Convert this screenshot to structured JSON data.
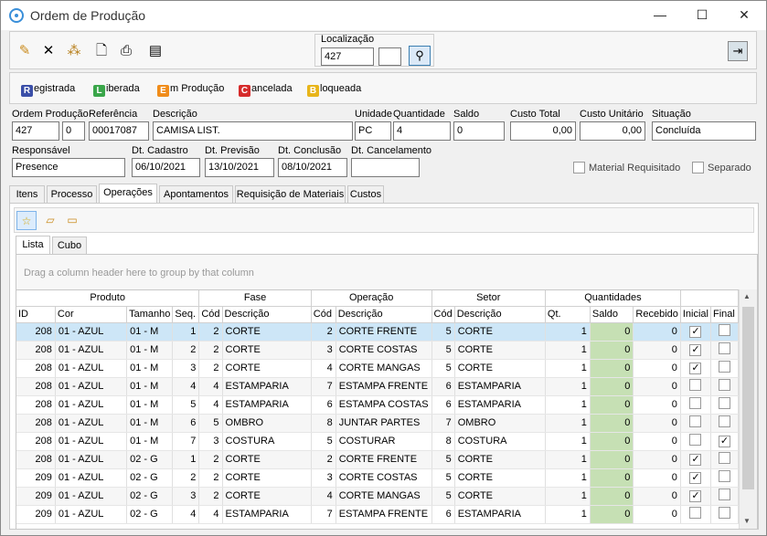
{
  "window": {
    "title": "Ordem de Produção",
    "minimize": "—",
    "maximize": "☐",
    "close": "✕"
  },
  "toolbar": {
    "localizacao_label": "Localização",
    "localizacao_value": "427",
    "localizacao_value2": ""
  },
  "legend": [
    {
      "letter": "R",
      "label": "egistrada",
      "color": "#3b4fa8"
    },
    {
      "letter": "L",
      "label": "iberada",
      "color": "#3aa64a"
    },
    {
      "letter": "E",
      "label": "m Produção",
      "color": "#f08c1a"
    },
    {
      "letter": "C",
      "label": "ancelada",
      "color": "#d62b2b"
    },
    {
      "letter": "B",
      "label": "loqueada",
      "color": "#e8b51a"
    }
  ],
  "form": {
    "ordem_producao_label": "Ordem Produção",
    "ordem_value": "427",
    "ordem_seq": "0",
    "referencia_label": "Referência",
    "referencia_value": "00017087",
    "descricao_label": "Descrição",
    "descricao_value": "CAMISA LIST.",
    "unidade_label": "Unidade",
    "unidade_value": "PC",
    "quantidade_label": "Quantidade",
    "quantidade_value": "4",
    "saldo_label": "Saldo",
    "saldo_value": "0",
    "custo_total_label": "Custo Total",
    "custo_total_value": "0,00",
    "custo_unitario_label": "Custo Unitário",
    "custo_unitario_value": "0,00",
    "situacao_label": "Situação",
    "situacao_value": "Concluída",
    "responsavel_label": "Responsável",
    "responsavel_value": "Presence",
    "dt_cadastro_label": "Dt. Cadastro",
    "dt_cadastro_value": "06/10/2021",
    "dt_previsao_label": "Dt. Previsão",
    "dt_previsao_value": "13/10/2021",
    "dt_conclusao_label": "Dt. Conclusão",
    "dt_conclusao_value": "08/10/2021",
    "dt_cancelamento_label": "Dt. Cancelamento",
    "dt_cancelamento_value": "",
    "material_requisitado_label": "Material Requisitado",
    "separado_label": "Separado"
  },
  "tabs": [
    "Itens",
    "Processo",
    "Operações",
    "Apontamentos",
    "Requisição de Materiais",
    "Custos"
  ],
  "active_tab": "Operações",
  "subtabs": [
    "Lista",
    "Cubo"
  ],
  "grid": {
    "group_hint": "Drag a column header here to group by that column",
    "groups": [
      "Produto",
      "Fase",
      "Operação",
      "Setor",
      "Quantidades"
    ],
    "columns": [
      "ID",
      "Cor",
      "Tamanho",
      "Seq.",
      "Cód",
      "Descrição",
      "Cód",
      "Descrição",
      "Cód",
      "Descrição",
      "Qt.",
      "Saldo",
      "Recebido",
      "Inicial",
      "Final"
    ],
    "rows": [
      {
        "id": "208",
        "cor": "01 - AZUL",
        "tam": "01 - M",
        "seq": "1",
        "fcod": "2",
        "fdesc": "CORTE",
        "ocod": "2",
        "odesc": "CORTE FRENTE",
        "scod": "5",
        "sdesc": "CORTE",
        "qt": "1",
        "saldo": "0",
        "rec": "0",
        "ini": true,
        "fin": false
      },
      {
        "id": "208",
        "cor": "01 - AZUL",
        "tam": "01 - M",
        "seq": "2",
        "fcod": "2",
        "fdesc": "CORTE",
        "ocod": "3",
        "odesc": "CORTE COSTAS",
        "scod": "5",
        "sdesc": "CORTE",
        "qt": "1",
        "saldo": "0",
        "rec": "0",
        "ini": true,
        "fin": false
      },
      {
        "id": "208",
        "cor": "01 - AZUL",
        "tam": "01 - M",
        "seq": "3",
        "fcod": "2",
        "fdesc": "CORTE",
        "ocod": "4",
        "odesc": "CORTE MANGAS",
        "scod": "5",
        "sdesc": "CORTE",
        "qt": "1",
        "saldo": "0",
        "rec": "0",
        "ini": true,
        "fin": false
      },
      {
        "id": "208",
        "cor": "01 - AZUL",
        "tam": "01 - M",
        "seq": "4",
        "fcod": "4",
        "fdesc": "ESTAMPARIA",
        "ocod": "7",
        "odesc": "ESTAMPA FRENTE",
        "scod": "6",
        "sdesc": "ESTAMPARIA",
        "qt": "1",
        "saldo": "0",
        "rec": "0",
        "ini": false,
        "fin": false
      },
      {
        "id": "208",
        "cor": "01 - AZUL",
        "tam": "01 - M",
        "seq": "5",
        "fcod": "4",
        "fdesc": "ESTAMPARIA",
        "ocod": "6",
        "odesc": "ESTAMPA COSTAS",
        "scod": "6",
        "sdesc": "ESTAMPARIA",
        "qt": "1",
        "saldo": "0",
        "rec": "0",
        "ini": false,
        "fin": false
      },
      {
        "id": "208",
        "cor": "01 - AZUL",
        "tam": "01 - M",
        "seq": "6",
        "fcod": "5",
        "fdesc": "OMBRO",
        "ocod": "8",
        "odesc": "JUNTAR PARTES",
        "scod": "7",
        "sdesc": "OMBRO",
        "qt": "1",
        "saldo": "0",
        "rec": "0",
        "ini": false,
        "fin": false
      },
      {
        "id": "208",
        "cor": "01 - AZUL",
        "tam": "01 - M",
        "seq": "7",
        "fcod": "3",
        "fdesc": "COSTURA",
        "ocod": "5",
        "odesc": "COSTURAR",
        "scod": "8",
        "sdesc": "COSTURA",
        "qt": "1",
        "saldo": "0",
        "rec": "0",
        "ini": false,
        "fin": true
      },
      {
        "id": "208",
        "cor": "01 - AZUL",
        "tam": "02 - G",
        "seq": "1",
        "fcod": "2",
        "fdesc": "CORTE",
        "ocod": "2",
        "odesc": "CORTE FRENTE",
        "scod": "5",
        "sdesc": "CORTE",
        "qt": "1",
        "saldo": "0",
        "rec": "0",
        "ini": true,
        "fin": false
      },
      {
        "id": "209",
        "cor": "01 - AZUL",
        "tam": "02 - G",
        "seq": "2",
        "fcod": "2",
        "fdesc": "CORTE",
        "ocod": "3",
        "odesc": "CORTE COSTAS",
        "scod": "5",
        "sdesc": "CORTE",
        "qt": "1",
        "saldo": "0",
        "rec": "0",
        "ini": true,
        "fin": false
      },
      {
        "id": "209",
        "cor": "01 - AZUL",
        "tam": "02 - G",
        "seq": "3",
        "fcod": "2",
        "fdesc": "CORTE",
        "ocod": "4",
        "odesc": "CORTE MANGAS",
        "scod": "5",
        "sdesc": "CORTE",
        "qt": "1",
        "saldo": "0",
        "rec": "0",
        "ini": true,
        "fin": false
      },
      {
        "id": "209",
        "cor": "01 - AZUL",
        "tam": "02 - G",
        "seq": "4",
        "fcod": "4",
        "fdesc": "ESTAMPARIA",
        "ocod": "7",
        "odesc": "ESTAMPA FRENTE",
        "scod": "6",
        "sdesc": "ESTAMPARIA",
        "qt": "1",
        "saldo": "0",
        "rec": "0",
        "ini": false,
        "fin": false
      }
    ]
  }
}
